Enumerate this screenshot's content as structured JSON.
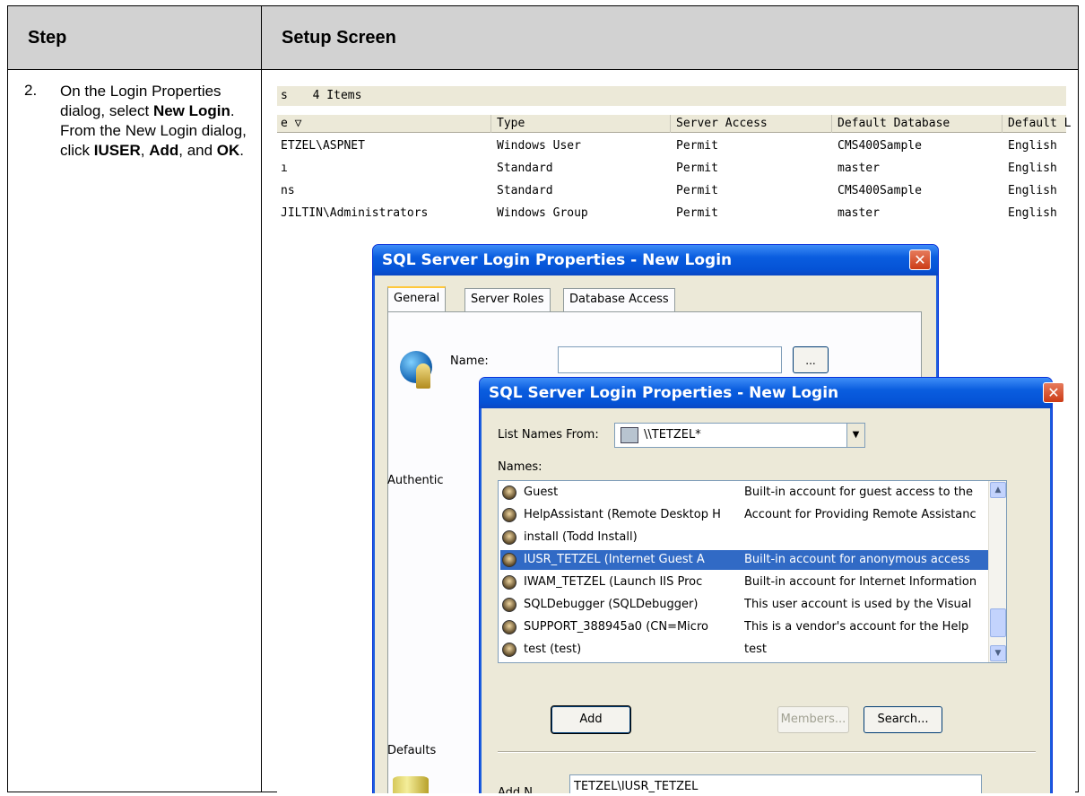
{
  "table": {
    "header_step": "Step",
    "header_setup": "Setup Screen",
    "step_number": "2.",
    "step_text": [
      {
        "t": "On the Login Properties dialog, select ",
        "b": false
      },
      {
        "t": "New Login",
        "b": true
      },
      {
        "t": ". From the New Login dialog, click ",
        "b": false
      },
      {
        "t": "IUSER",
        "b": true
      },
      {
        "t": ", ",
        "b": false
      },
      {
        "t": "Add",
        "b": true
      },
      {
        "t": ", and ",
        "b": false
      },
      {
        "t": "OK",
        "b": true
      },
      {
        "t": ".",
        "b": false
      }
    ]
  },
  "background_window": {
    "title_prefix": "s",
    "item_count": "4 Items",
    "columns": [
      "e  ▽",
      "Type",
      "Server Access",
      "Default Database",
      "Default L"
    ],
    "rows": [
      [
        "ETZEL\\ASPNET",
        "Windows User",
        "Permit",
        "CMS400Sample",
        "English"
      ],
      [
        "ı",
        "Standard",
        "Permit",
        "master",
        "English"
      ],
      [
        "ns",
        "Standard",
        "Permit",
        "CMS400Sample",
        "English"
      ],
      [
        "JILTIN\\Administrators",
        "Windows Group",
        "Permit",
        "master",
        "English"
      ]
    ]
  },
  "dialog1": {
    "title": "SQL Server Login Properties - New Login",
    "close_glyph": "✕",
    "tabs": [
      "General",
      "Server Roles",
      "Database Access"
    ],
    "name_label": "Name:",
    "name_value": "",
    "browse_label": "...",
    "auth_label": "Authentic",
    "defaults_label": "Defaults"
  },
  "dialog2": {
    "title": "SQL Server Login Properties - New Login",
    "close_glyph": "✕",
    "list_names_from_label": "List Names From:",
    "list_names_from_value": "\\\\TETZEL*",
    "combo_arrow": "▼",
    "names_label": "Names:",
    "names": [
      {
        "name": "Guest",
        "desc": "Built-in account for guest access to the",
        "selected": false
      },
      {
        "name": "HelpAssistant (Remote Desktop H",
        "desc": "Account for Providing Remote Assistanc",
        "selected": false
      },
      {
        "name": "install (Todd Install)",
        "desc": "",
        "selected": false
      },
      {
        "name": "IUSR_TETZEL (Internet Guest A",
        "desc": "Built-in account for anonymous access",
        "selected": true
      },
      {
        "name": "IWAM_TETZEL (Launch IIS Proc",
        "desc": "Built-in account for Internet Information",
        "selected": false
      },
      {
        "name": "SQLDebugger (SQLDebugger)",
        "desc": "This user account is used by the Visual",
        "selected": false
      },
      {
        "name": "SUPPORT_388945a0 (CN=Micro",
        "desc": "This is a vendor's account for the Help",
        "selected": false
      },
      {
        "name": "test (test)",
        "desc": "test",
        "selected": false
      }
    ],
    "scroll_up": "▲",
    "scroll_down": "▼",
    "add_button": "Add",
    "members_button": "Members...",
    "search_button": "Search...",
    "add_label": "Add N",
    "add_value": "TETZEL\\IUSR_TETZEL"
  }
}
